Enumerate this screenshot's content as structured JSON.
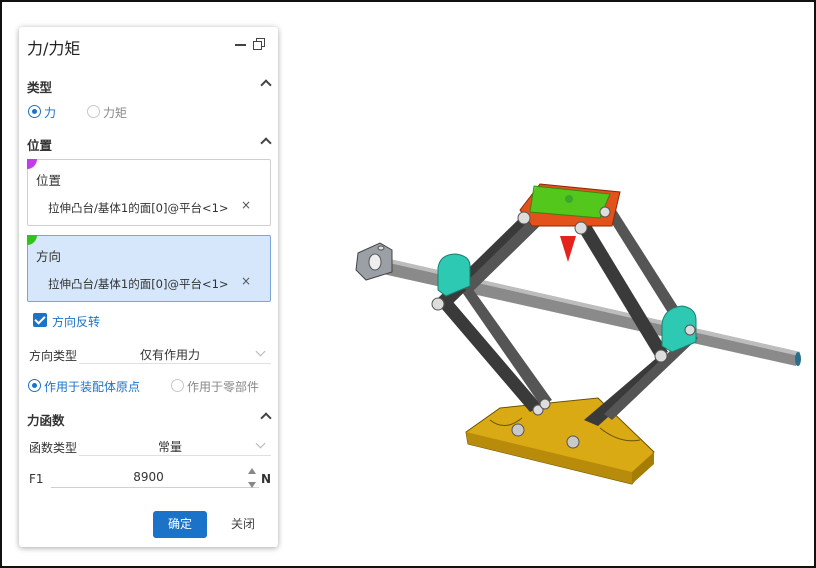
{
  "panel": {
    "title": "力/力矩",
    "type_section": {
      "title": "类型",
      "options": [
        "力",
        "力矩"
      ],
      "selected": "力"
    },
    "position_section": {
      "title": "位置",
      "position_box": {
        "label": "位置",
        "value": "拉伸凸台/基体1的面[0]@平台<1>",
        "remove": "×",
        "marker_color": "#c23ce8"
      },
      "direction_box": {
        "label": "方向",
        "value": "拉伸凸台/基体1的面[0]@平台<1>",
        "remove": "×",
        "marker_color": "#2ec51a"
      },
      "reverse_checkbox": {
        "label": "方向反转",
        "checked": true
      },
      "direction_type": {
        "label": "方向类型",
        "value": "仅有作用力"
      },
      "apply_options": [
        "作用于装配体原点",
        "作用于零部件"
      ],
      "apply_selected": "作用于装配体原点"
    },
    "force_function_section": {
      "title": "力函数",
      "function_type": {
        "label": "函数类型",
        "value": "常量"
      },
      "f1": {
        "label": "F1",
        "value": "8900",
        "unit": "N"
      }
    },
    "buttons": {
      "ok": "确定",
      "close": "关闭"
    }
  },
  "colors": {
    "accent": "#1a73c9",
    "platform_orange": "#e2521a",
    "highlight_green": "#45d41e",
    "arrow_red": "#e4231c",
    "base_yellow": "#e3b81c",
    "connector_teal": "#2ec9b3",
    "arm_dark": "#3a3a3a"
  }
}
